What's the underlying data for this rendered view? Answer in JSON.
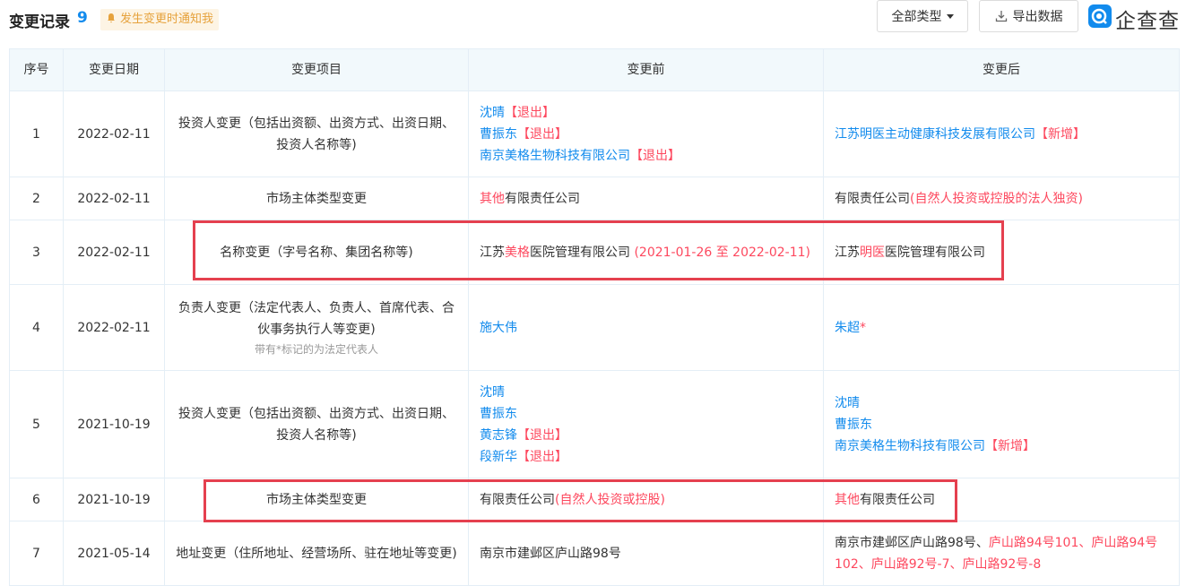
{
  "header": {
    "title": "变更记录",
    "count": "9",
    "notify_label": "发生变更时通知我",
    "type_filter_label": "全部类型",
    "export_label": "导出数据",
    "logo_text": "企查查"
  },
  "columns": [
    "序号",
    "变更日期",
    "变更项目",
    "变更前",
    "变更后"
  ],
  "rows": [
    {
      "no": "1",
      "date": "2022-02-11",
      "item": "投资人变更（包括出资额、出资方式、出资日期、投资人名称等)",
      "before": [
        {
          "name": "沈晴",
          "tag": "【退出】"
        },
        {
          "name": "曹振东",
          "tag": "【退出】"
        },
        {
          "name": "南京美格生物科技有限公司",
          "tag": "【退出】"
        }
      ],
      "after": [
        {
          "name": "江苏明医主动健康科技发展有限公司",
          "tag": "【新增】"
        }
      ]
    },
    {
      "no": "2",
      "date": "2022-02-11",
      "item": "市场主体类型变更",
      "before_red": "其他",
      "before_text": "有限责任公司",
      "after_text": "有限责任公司",
      "after_red": "(自然人投资或控股的法人独资)"
    },
    {
      "no": "3",
      "date": "2022-02-11",
      "item": "名称变更（字号名称、集团名称等)",
      "before_p1": "江苏",
      "before_red": "美格",
      "before_p2": "医院管理有限公司",
      "before_period": "(2021-01-26 至 2022-02-11)",
      "after_p1": "江苏",
      "after_red": "明医",
      "after_p2": "医院管理有限公司"
    },
    {
      "no": "4",
      "date": "2022-02-11",
      "item": "负责人变更（法定代表人、负责人、首席代表、合伙事务执行人等变更)",
      "item_note": "带有*标记的为法定代表人",
      "before": "施大伟",
      "after": "朱超",
      "after_mark": "*"
    },
    {
      "no": "5",
      "date": "2021-10-19",
      "item": "投资人变更（包括出资额、出资方式、出资日期、投资人名称等)",
      "before": [
        {
          "name": "沈晴",
          "tag": ""
        },
        {
          "name": "曹振东",
          "tag": ""
        },
        {
          "name": "黄志锋",
          "tag": "【退出】"
        },
        {
          "name": "段新华",
          "tag": "【退出】"
        }
      ],
      "after": [
        {
          "name": "沈晴",
          "tag": ""
        },
        {
          "name": "曹振东",
          "tag": ""
        },
        {
          "name": "南京美格生物科技有限公司",
          "tag": "【新增】"
        }
      ]
    },
    {
      "no": "6",
      "date": "2021-10-19",
      "item": "市场主体类型变更",
      "before_text": "有限责任公司",
      "before_red": "(自然人投资或控股)",
      "after_red": "其他",
      "after_text": "有限责任公司"
    },
    {
      "no": "7",
      "date": "2021-05-14",
      "item": "地址变更（住所地址、经营场所、驻在地址等变更)",
      "before": "南京市建邺区庐山路98号",
      "after_text": "南京市建邺区庐山路98号、",
      "after_red": "庐山路94号101、庐山路94号102、庐山路92号-7、庐山路92号-8"
    }
  ],
  "colors": {
    "accent": "#128bed",
    "highlight": "#fd485e",
    "annotation_box": "#e5404f"
  }
}
